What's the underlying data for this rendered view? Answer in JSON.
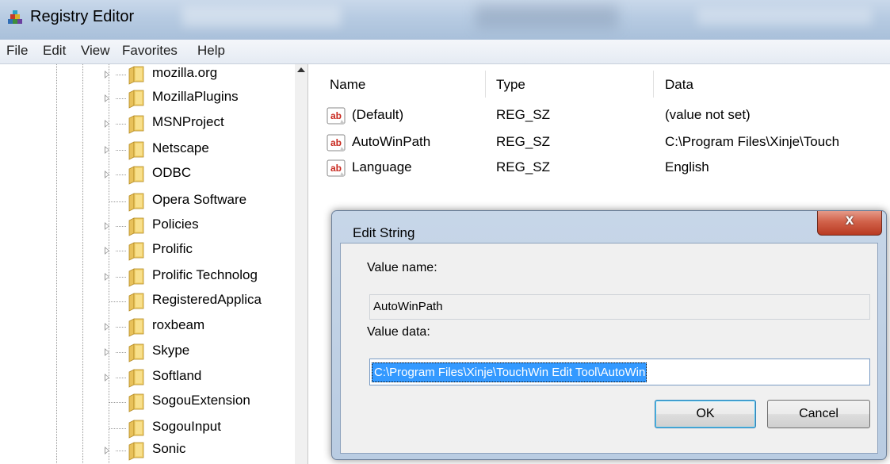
{
  "window": {
    "title": "Registry Editor"
  },
  "menu": [
    "File",
    "Edit",
    "View",
    "Favorites",
    "Help"
  ],
  "tree": {
    "items": [
      {
        "label": "mozilla.org",
        "expandable": true
      },
      {
        "label": "MozillaPlugins",
        "expandable": true
      },
      {
        "label": "MSNProject",
        "expandable": true
      },
      {
        "label": "Netscape",
        "expandable": true
      },
      {
        "label": "ODBC",
        "expandable": true
      },
      {
        "label": "Opera Software",
        "expandable": false
      },
      {
        "label": "Policies",
        "expandable": true
      },
      {
        "label": "Prolific",
        "expandable": true
      },
      {
        "label": "Prolific Technolog",
        "expandable": true
      },
      {
        "label": "RegisteredApplica",
        "expandable": false
      },
      {
        "label": "roxbeam",
        "expandable": true
      },
      {
        "label": "Skype",
        "expandable": true
      },
      {
        "label": "Softland",
        "expandable": true
      },
      {
        "label": "SogouExtension",
        "expandable": false
      },
      {
        "label": "SogouInput",
        "expandable": false
      },
      {
        "label": "Sonic",
        "expandable": true
      }
    ]
  },
  "list": {
    "columns": [
      "Name",
      "Type",
      "Data"
    ],
    "rows": [
      {
        "name": "(Default)",
        "type": "REG_SZ",
        "data": "(value not set)"
      },
      {
        "name": "AutoWinPath",
        "type": "REG_SZ",
        "data": "C:\\Program Files\\Xinje\\Touch"
      },
      {
        "name": "Language",
        "type": "REG_SZ",
        "data": "English"
      }
    ]
  },
  "dialog": {
    "title": "Edit String",
    "close_glyph": "x",
    "value_name_label": "Value name:",
    "value_name": "AutoWinPath",
    "value_data_label": "Value data:",
    "value_data": "C:\\Program Files\\Xinje\\TouchWin Edit Tool\\AutoWin",
    "ok_label": "OK",
    "cancel_label": "Cancel"
  },
  "colors": {
    "selection": "#3399ff",
    "close_button": "#c7482f",
    "dialog_frame": "#b9cce2"
  }
}
